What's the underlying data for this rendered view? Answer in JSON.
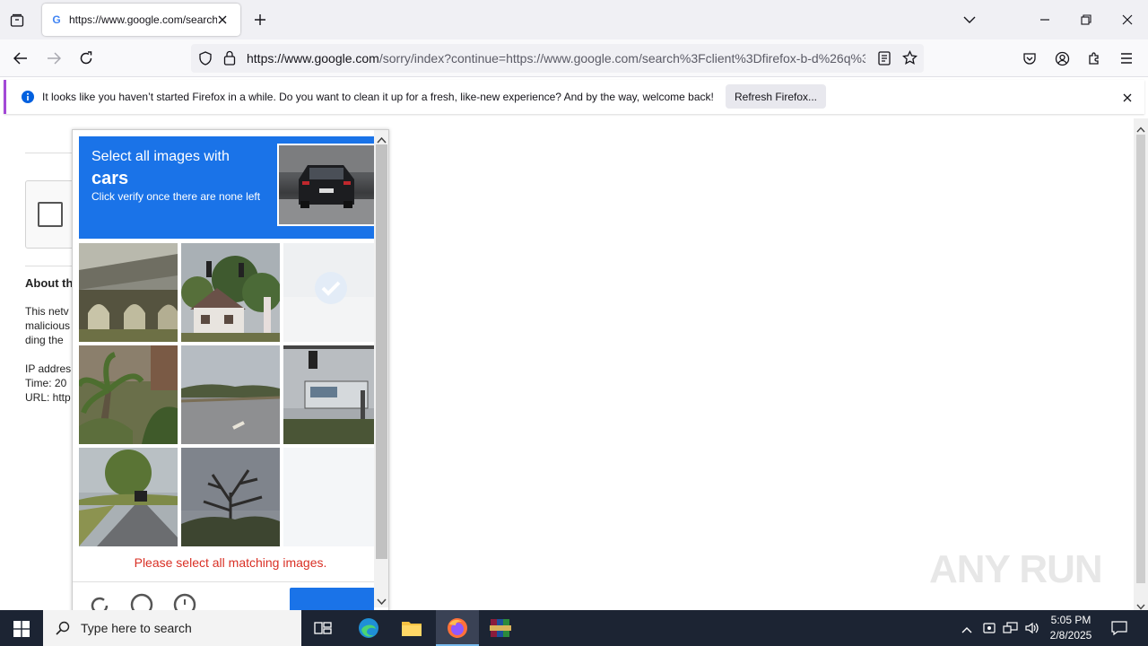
{
  "browser": {
    "tab_title": "https://www.google.com/search",
    "url_host": "https://www.google.com",
    "url_path": "/sorry/index?continue=https://www.google.com/search%3Fclient%3Dfirefox-b-d%26q%3D"
  },
  "notification": {
    "message": "It looks like you haven’t started Firefox in a while. Do you want to clean it up for a fresh, like-new experience? And by the way, welcome back!",
    "button_label": "Refresh Firefox..."
  },
  "background_page": {
    "about_heading": "About th",
    "line1": "This netv",
    "line2": "malicious",
    "line3": "ding the",
    "ip_label": "IP addres",
    "time_label": "Time: 20",
    "url_label": "URL: http"
  },
  "captcha": {
    "instruction_line1": "Select all images with",
    "target_object": "cars",
    "instruction_line3": "Click verify once there are none left",
    "error_message": "Please select all matching images.",
    "tiles": [
      {
        "scene": "bridge",
        "selected": false
      },
      {
        "scene": "house-traffic-light",
        "selected": false
      },
      {
        "scene": "fading-selected",
        "selected": true
      },
      {
        "scene": "palm-trees",
        "selected": false
      },
      {
        "scene": "road",
        "selected": false
      },
      {
        "scene": "traffic-light-sign",
        "selected": false
      },
      {
        "scene": "road-car",
        "selected": false
      },
      {
        "scene": "bare-tree",
        "selected": false
      },
      {
        "scene": "loading-blank",
        "selected": false
      }
    ]
  },
  "taskbar": {
    "search_placeholder": "Type here to search",
    "time": "5:05 PM",
    "date": "2/8/2025"
  },
  "watermark": "ANY RUN",
  "colors": {
    "captcha_blue": "#1a73e8",
    "error_red": "#d93025",
    "taskbar": "#1c2433"
  }
}
